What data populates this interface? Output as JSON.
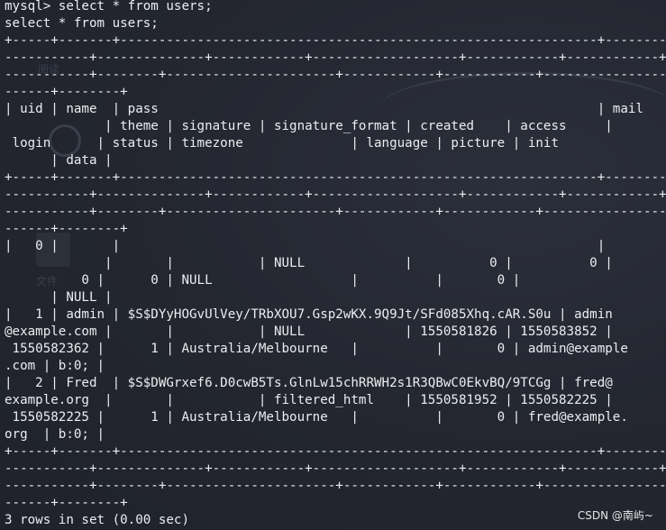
{
  "terminal": {
    "lines": [
      "mysql> select * from users;",
      "select * from users;",
      "+-----+-------+--------------------------------------------------------------+-----------",
      "-----------+--------------+------------+-------------------+------------+------------+-----------",
      "-----------+--------+----------------------+------------+------------+----------------------------",
      "------+--------+",
      "| uid | name  | pass                                                         | mail",
      "             | theme | signature | signature_format | created    | access     |",
      " login      | status | timezone              | language | picture | init",
      "      | data |",
      "+-----+-------+--------------------------------------------------------------+-----------",
      "-----------+--------------+------------+-------------------+------------+------------+-----------",
      "-----------+--------+----------------------+------------+------------+----------------------------",
      "------+--------+",
      "|   0 |       |                                                              |",
      "             |       |           | NULL             |          0 |          0 |",
      "          0 |      0 | NULL                  |          |       0 |",
      "      | NULL |",
      "|   1 | admin | $S$DYyHOGvUlVey/TRbXOU7.Gsp2wKX.9Q9Jt/SFd085Xhq.cAR.S0u | admin",
      "@example.com |       |           | NULL             | 1550581826 | 1550583852 |",
      " 1550582362 |      1 | Australia/Melbourne   |          |       0 | admin@example",
      ".com | b:0; |",
      "|   2 | Fred  | $S$DWGrxef6.D0cwB5Ts.GlnLw15chRRWH2s1R3QBwC0EkvBQ/9TCGg | fred@",
      "example.org  |       |           | filtered_html    | 1550581952 | 1550582225 |",
      " 1550582225 |      1 | Australia/Melbourne   |          |       0 | fred@example.",
      "org  | b:0; |",
      "+-----+-------+--------------------------------------------------------------+-----------",
      "-----------+--------------+------------+-------------------+------------+------------+-----------",
      "-----------+--------+----------------------+------------+------------+----------------------------",
      "------+--------+",
      "3 rows in set (0.00 sec)"
    ]
  },
  "watermark": "CSDN @南屿~"
}
